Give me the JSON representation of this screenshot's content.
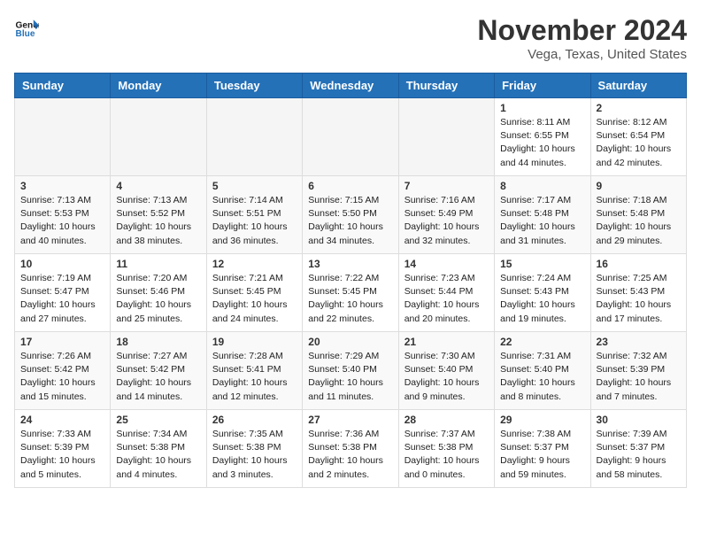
{
  "logo": {
    "text_general": "General",
    "text_blue": "Blue"
  },
  "header": {
    "month": "November 2024",
    "location": "Vega, Texas, United States"
  },
  "weekdays": [
    "Sunday",
    "Monday",
    "Tuesday",
    "Wednesday",
    "Thursday",
    "Friday",
    "Saturday"
  ],
  "weeks": [
    [
      {
        "day": "",
        "info": ""
      },
      {
        "day": "",
        "info": ""
      },
      {
        "day": "",
        "info": ""
      },
      {
        "day": "",
        "info": ""
      },
      {
        "day": "",
        "info": ""
      },
      {
        "day": "1",
        "info": "Sunrise: 8:11 AM\nSunset: 6:55 PM\nDaylight: 10 hours\nand 44 minutes."
      },
      {
        "day": "2",
        "info": "Sunrise: 8:12 AM\nSunset: 6:54 PM\nDaylight: 10 hours\nand 42 minutes."
      }
    ],
    [
      {
        "day": "3",
        "info": "Sunrise: 7:13 AM\nSunset: 5:53 PM\nDaylight: 10 hours\nand 40 minutes."
      },
      {
        "day": "4",
        "info": "Sunrise: 7:13 AM\nSunset: 5:52 PM\nDaylight: 10 hours\nand 38 minutes."
      },
      {
        "day": "5",
        "info": "Sunrise: 7:14 AM\nSunset: 5:51 PM\nDaylight: 10 hours\nand 36 minutes."
      },
      {
        "day": "6",
        "info": "Sunrise: 7:15 AM\nSunset: 5:50 PM\nDaylight: 10 hours\nand 34 minutes."
      },
      {
        "day": "7",
        "info": "Sunrise: 7:16 AM\nSunset: 5:49 PM\nDaylight: 10 hours\nand 32 minutes."
      },
      {
        "day": "8",
        "info": "Sunrise: 7:17 AM\nSunset: 5:48 PM\nDaylight: 10 hours\nand 31 minutes."
      },
      {
        "day": "9",
        "info": "Sunrise: 7:18 AM\nSunset: 5:48 PM\nDaylight: 10 hours\nand 29 minutes."
      }
    ],
    [
      {
        "day": "10",
        "info": "Sunrise: 7:19 AM\nSunset: 5:47 PM\nDaylight: 10 hours\nand 27 minutes."
      },
      {
        "day": "11",
        "info": "Sunrise: 7:20 AM\nSunset: 5:46 PM\nDaylight: 10 hours\nand 25 minutes."
      },
      {
        "day": "12",
        "info": "Sunrise: 7:21 AM\nSunset: 5:45 PM\nDaylight: 10 hours\nand 24 minutes."
      },
      {
        "day": "13",
        "info": "Sunrise: 7:22 AM\nSunset: 5:45 PM\nDaylight: 10 hours\nand 22 minutes."
      },
      {
        "day": "14",
        "info": "Sunrise: 7:23 AM\nSunset: 5:44 PM\nDaylight: 10 hours\nand 20 minutes."
      },
      {
        "day": "15",
        "info": "Sunrise: 7:24 AM\nSunset: 5:43 PM\nDaylight: 10 hours\nand 19 minutes."
      },
      {
        "day": "16",
        "info": "Sunrise: 7:25 AM\nSunset: 5:43 PM\nDaylight: 10 hours\nand 17 minutes."
      }
    ],
    [
      {
        "day": "17",
        "info": "Sunrise: 7:26 AM\nSunset: 5:42 PM\nDaylight: 10 hours\nand 15 minutes."
      },
      {
        "day": "18",
        "info": "Sunrise: 7:27 AM\nSunset: 5:42 PM\nDaylight: 10 hours\nand 14 minutes."
      },
      {
        "day": "19",
        "info": "Sunrise: 7:28 AM\nSunset: 5:41 PM\nDaylight: 10 hours\nand 12 minutes."
      },
      {
        "day": "20",
        "info": "Sunrise: 7:29 AM\nSunset: 5:40 PM\nDaylight: 10 hours\nand 11 minutes."
      },
      {
        "day": "21",
        "info": "Sunrise: 7:30 AM\nSunset: 5:40 PM\nDaylight: 10 hours\nand 9 minutes."
      },
      {
        "day": "22",
        "info": "Sunrise: 7:31 AM\nSunset: 5:40 PM\nDaylight: 10 hours\nand 8 minutes."
      },
      {
        "day": "23",
        "info": "Sunrise: 7:32 AM\nSunset: 5:39 PM\nDaylight: 10 hours\nand 7 minutes."
      }
    ],
    [
      {
        "day": "24",
        "info": "Sunrise: 7:33 AM\nSunset: 5:39 PM\nDaylight: 10 hours\nand 5 minutes."
      },
      {
        "day": "25",
        "info": "Sunrise: 7:34 AM\nSunset: 5:38 PM\nDaylight: 10 hours\nand 4 minutes."
      },
      {
        "day": "26",
        "info": "Sunrise: 7:35 AM\nSunset: 5:38 PM\nDaylight: 10 hours\nand 3 minutes."
      },
      {
        "day": "27",
        "info": "Sunrise: 7:36 AM\nSunset: 5:38 PM\nDaylight: 10 hours\nand 2 minutes."
      },
      {
        "day": "28",
        "info": "Sunrise: 7:37 AM\nSunset: 5:38 PM\nDaylight: 10 hours\nand 0 minutes."
      },
      {
        "day": "29",
        "info": "Sunrise: 7:38 AM\nSunset: 5:37 PM\nDaylight: 9 hours\nand 59 minutes."
      },
      {
        "day": "30",
        "info": "Sunrise: 7:39 AM\nSunset: 5:37 PM\nDaylight: 9 hours\nand 58 minutes."
      }
    ]
  ]
}
